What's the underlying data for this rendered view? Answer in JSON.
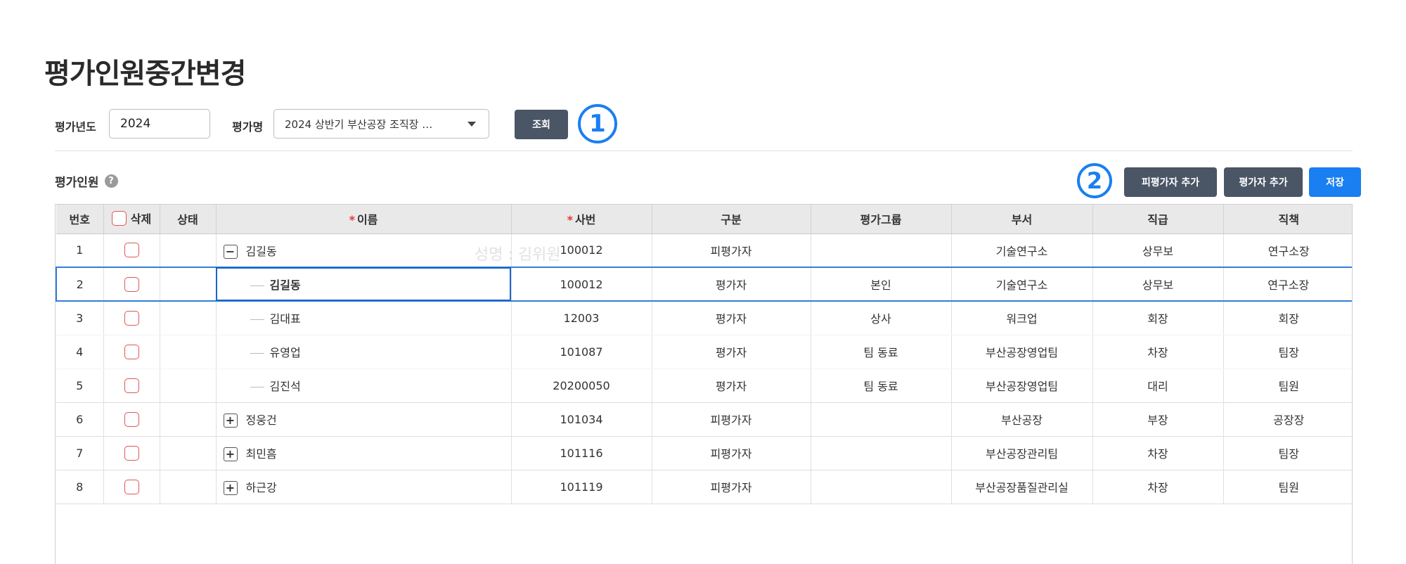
{
  "page": {
    "title": "평가인원중간변경"
  },
  "filters": {
    "year_label": "평가년도",
    "year_value": "2024",
    "name_label": "평가명",
    "name_value": "2024 상반기 부산공장 조직장 …",
    "search_button": "조회"
  },
  "annotations": {
    "marker1": "1",
    "marker2": "2"
  },
  "section": {
    "title": "평가인원",
    "help_icon": "?",
    "add_evaluatee_button": "피평가자 추가",
    "add_evaluator_button": "평가자 추가",
    "save_button": "저장"
  },
  "watermark": "성명 : 김위원",
  "colors": {
    "accent": "#1a7ff0",
    "dark_button": "#4a5566",
    "required": "#e53935",
    "delete_checkbox": "#e05555",
    "selection": "#2f7fd8"
  },
  "table": {
    "columns": {
      "no": "번호",
      "delete": "삭제",
      "status": "상태",
      "name": "이름",
      "emp_no": "사번",
      "type": "구분",
      "eval_group": "평가그룹",
      "dept": "부서",
      "grade": "직급",
      "position": "직책"
    },
    "required_mark": "*",
    "rows": [
      {
        "no": "1",
        "status": "",
        "tree": "minus",
        "name": "김길동",
        "emp_no": "100012",
        "type": "피평가자",
        "eval_group": "",
        "dept": "기술연구소",
        "grade": "상무보",
        "position": "연구소장"
      },
      {
        "no": "2",
        "status": "",
        "tree": "child",
        "name": "김길동",
        "emp_no": "100012",
        "type": "평가자",
        "eval_group": "본인",
        "dept": "기술연구소",
        "grade": "상무보",
        "position": "연구소장"
      },
      {
        "no": "3",
        "status": "",
        "tree": "child",
        "name": "김대표",
        "emp_no": "12003",
        "type": "평가자",
        "eval_group": "상사",
        "dept": "워크업",
        "grade": "회장",
        "position": "회장"
      },
      {
        "no": "4",
        "status": "",
        "tree": "child",
        "name": "유영업",
        "emp_no": "101087",
        "type": "평가자",
        "eval_group": "팀 동료",
        "dept": "부산공장영업팀",
        "grade": "차장",
        "position": "팀장"
      },
      {
        "no": "5",
        "status": "",
        "tree": "child",
        "name": "김진석",
        "emp_no": "20200050",
        "type": "평가자",
        "eval_group": "팀 동료",
        "dept": "부산공장영업팀",
        "grade": "대리",
        "position": "팀원"
      },
      {
        "no": "6",
        "status": "",
        "tree": "plus",
        "name": "정웅건",
        "emp_no": "101034",
        "type": "피평가자",
        "eval_group": "",
        "dept": "부산공장",
        "grade": "부장",
        "position": "공장장"
      },
      {
        "no": "7",
        "status": "",
        "tree": "plus",
        "name": "최민흠",
        "emp_no": "101116",
        "type": "피평가자",
        "eval_group": "",
        "dept": "부산공장관리팀",
        "grade": "차장",
        "position": "팀장"
      },
      {
        "no": "8",
        "status": "",
        "tree": "plus",
        "name": "하근강",
        "emp_no": "101119",
        "type": "피평가자",
        "eval_group": "",
        "dept": "부산공장품질관리실",
        "grade": "차장",
        "position": "팀원"
      }
    ]
  }
}
